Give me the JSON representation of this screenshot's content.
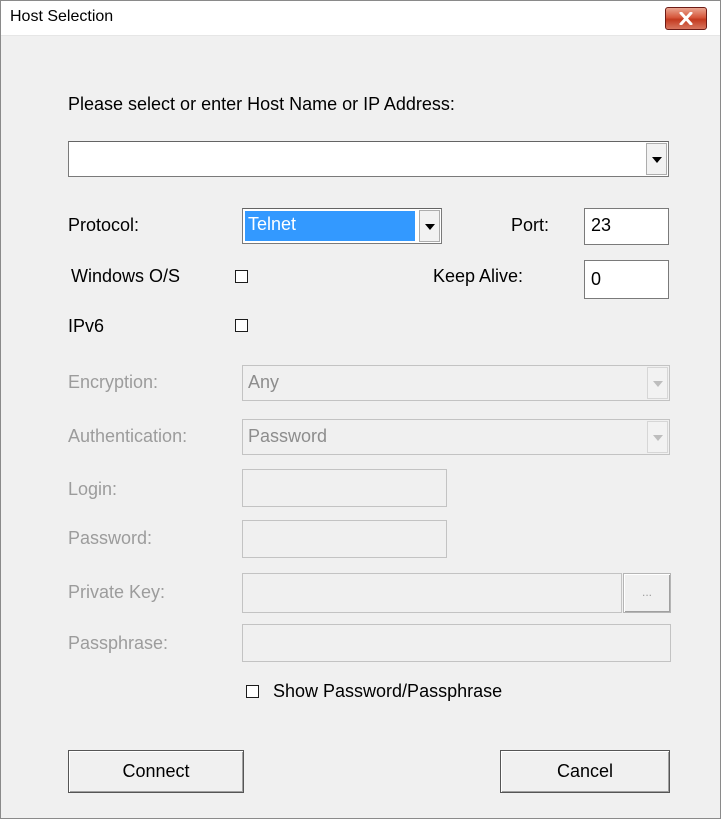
{
  "window": {
    "title": "Host Selection"
  },
  "prompt": "Please select or enter Host Name or IP Address:",
  "host": {
    "value": ""
  },
  "protocol": {
    "label": "Protocol:",
    "value": "Telnet"
  },
  "port": {
    "label": "Port:",
    "value": "23"
  },
  "windows_os": {
    "label": "Windows O/S",
    "checked": false
  },
  "keep_alive": {
    "label": "Keep Alive:",
    "value": "0"
  },
  "ipv6": {
    "label": "IPv6",
    "checked": false
  },
  "encryption": {
    "label": "Encryption:",
    "value": "Any"
  },
  "authentication": {
    "label": "Authentication:",
    "value": "Password"
  },
  "login": {
    "label": "Login:",
    "value": ""
  },
  "password": {
    "label": "Password:",
    "value": ""
  },
  "private_key": {
    "label": "Private Key:",
    "value": "",
    "browse_label": "..."
  },
  "passphrase": {
    "label": "Passphrase:",
    "value": ""
  },
  "show_password": {
    "label": "Show Password/Passphrase",
    "checked": false
  },
  "buttons": {
    "connect": "Connect",
    "cancel": "Cancel"
  }
}
